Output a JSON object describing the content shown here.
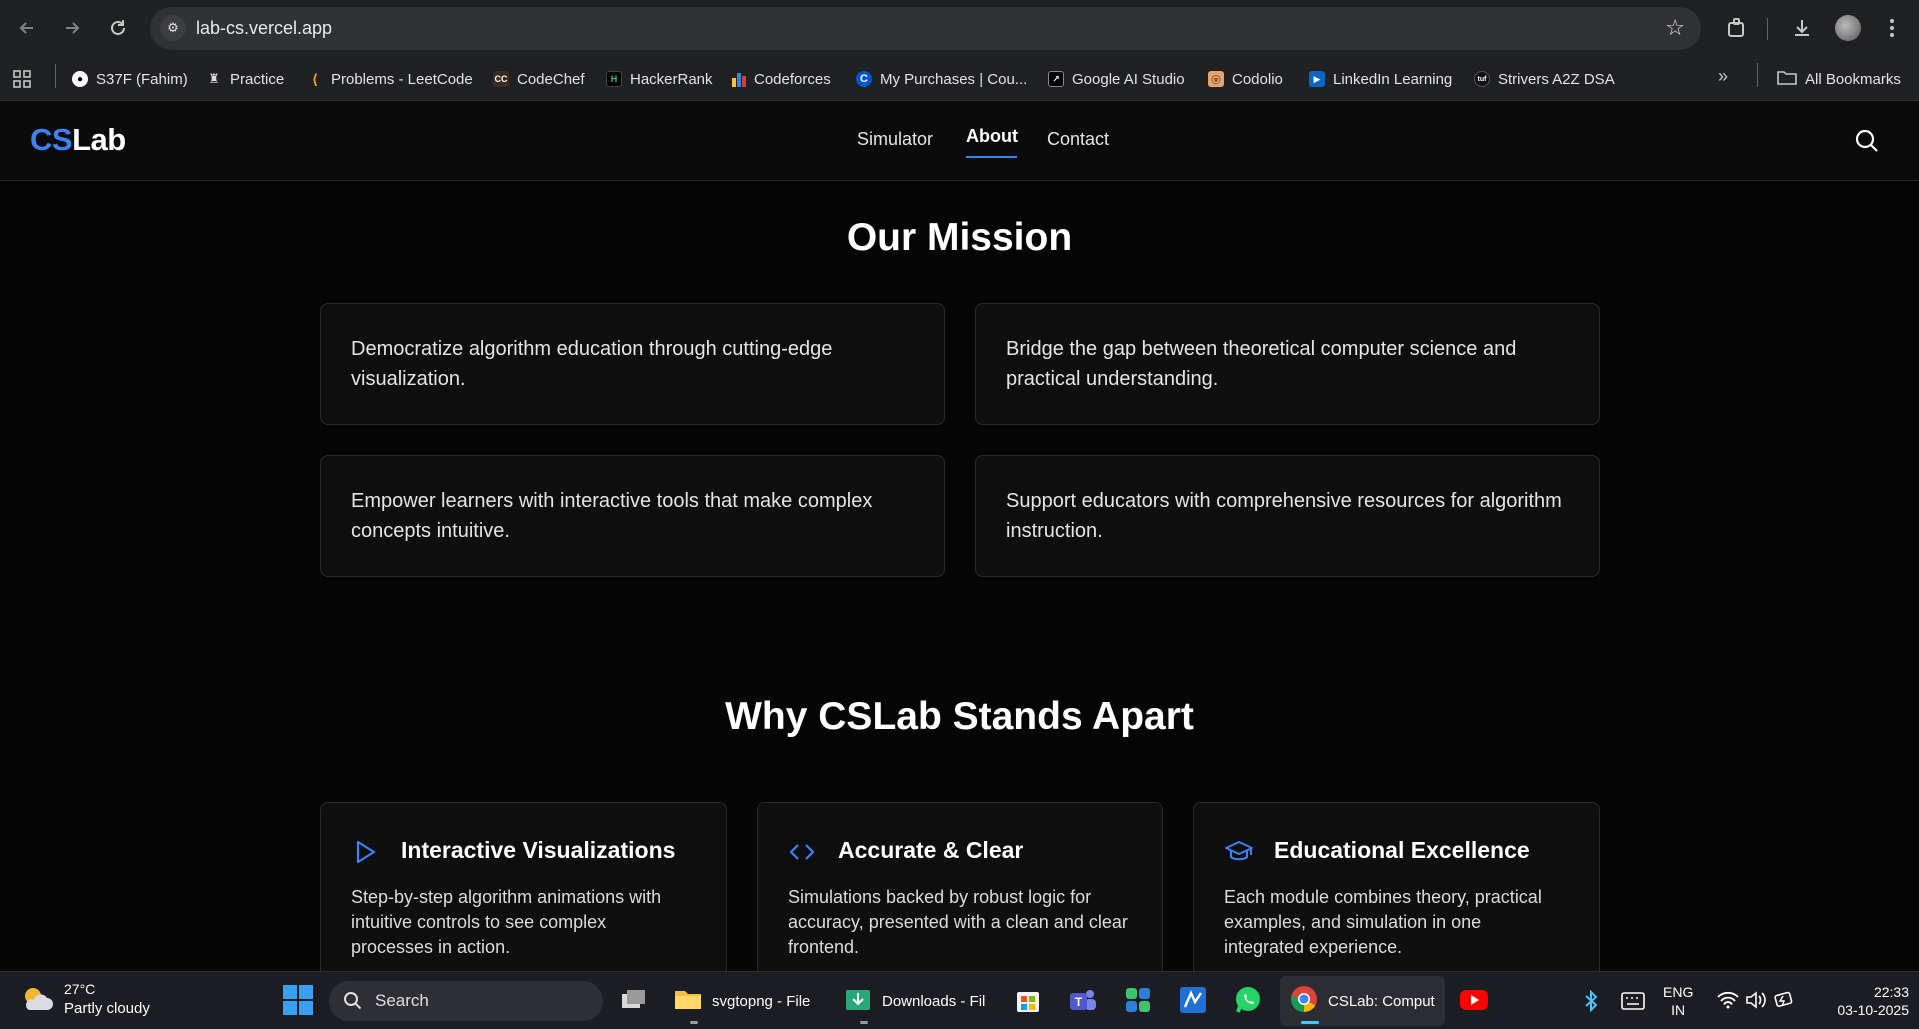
{
  "browser": {
    "url": "lab-cs.vercel.app",
    "bookmarks": [
      {
        "label": "S37F (Fahim)",
        "icon": "github-icon"
      },
      {
        "label": "Practice",
        "icon": "rocket-icon"
      },
      {
        "label": "Problems - LeetCode",
        "icon": "leetcode-icon"
      },
      {
        "label": "CodeChef",
        "icon": "codechef-icon"
      },
      {
        "label": "HackerRank",
        "icon": "hackerrank-icon"
      },
      {
        "label": "Codeforces",
        "icon": "codeforces-icon"
      },
      {
        "label": "My Purchases | Cou...",
        "icon": "coursera-icon"
      },
      {
        "label": "Google AI Studio",
        "icon": "ai-studio-icon"
      },
      {
        "label": "Codolio",
        "icon": "codolio-icon"
      },
      {
        "label": "LinkedIn Learning",
        "icon": "linkedin-learning-icon"
      },
      {
        "label": "Strivers A2Z DSA",
        "icon": "tuf-icon"
      }
    ],
    "all_bookmarks": "All Bookmarks"
  },
  "site": {
    "logo_cs": "CS",
    "logo_lab": "Lab",
    "nav": [
      "Simulator",
      "About",
      "Contact"
    ],
    "active_nav": "About"
  },
  "mission": {
    "title": "Our Mission",
    "items": [
      "Democratize algorithm education through cutting-edge visualization.",
      "Bridge the gap between theoretical computer science and practical understanding.",
      "Empower learners with interactive tools that make complex concepts intuitive.",
      "Support educators with comprehensive resources for algorithm instruction."
    ]
  },
  "features": {
    "title": "Why CSLab Stands Apart",
    "items": [
      {
        "title": "Interactive Visualizations",
        "desc": "Step-by-step algorithm animations with intuitive controls to see complex processes in action.",
        "icon": "play-icon"
      },
      {
        "title": "Accurate & Clear",
        "desc": "Simulations backed by robust logic for accuracy, presented with a clean and clear frontend.",
        "icon": "code-icon"
      },
      {
        "title": "Educational Excellence",
        "desc": "Each module combines theory, practical examples, and simulation in one integrated experience.",
        "icon": "graduation-cap-icon"
      }
    ]
  },
  "taskbar": {
    "weather_temp": "27°C",
    "weather_desc": "Partly cloudy",
    "search_placeholder": "Search",
    "apps": [
      {
        "label": "svgtopng - File",
        "icon": "file-explorer-icon"
      },
      {
        "label": "Downloads - Fil",
        "icon": "downloads-icon"
      },
      {
        "label": "CSLab: Comput",
        "icon": "chrome-icon"
      }
    ],
    "lang_top": "ENG",
    "lang_bottom": "IN",
    "time": "22:33",
    "date": "03-10-2025"
  },
  "colors": {
    "accent": "#3b82f6",
    "background": "#050505",
    "card": "#0e0e0f"
  }
}
